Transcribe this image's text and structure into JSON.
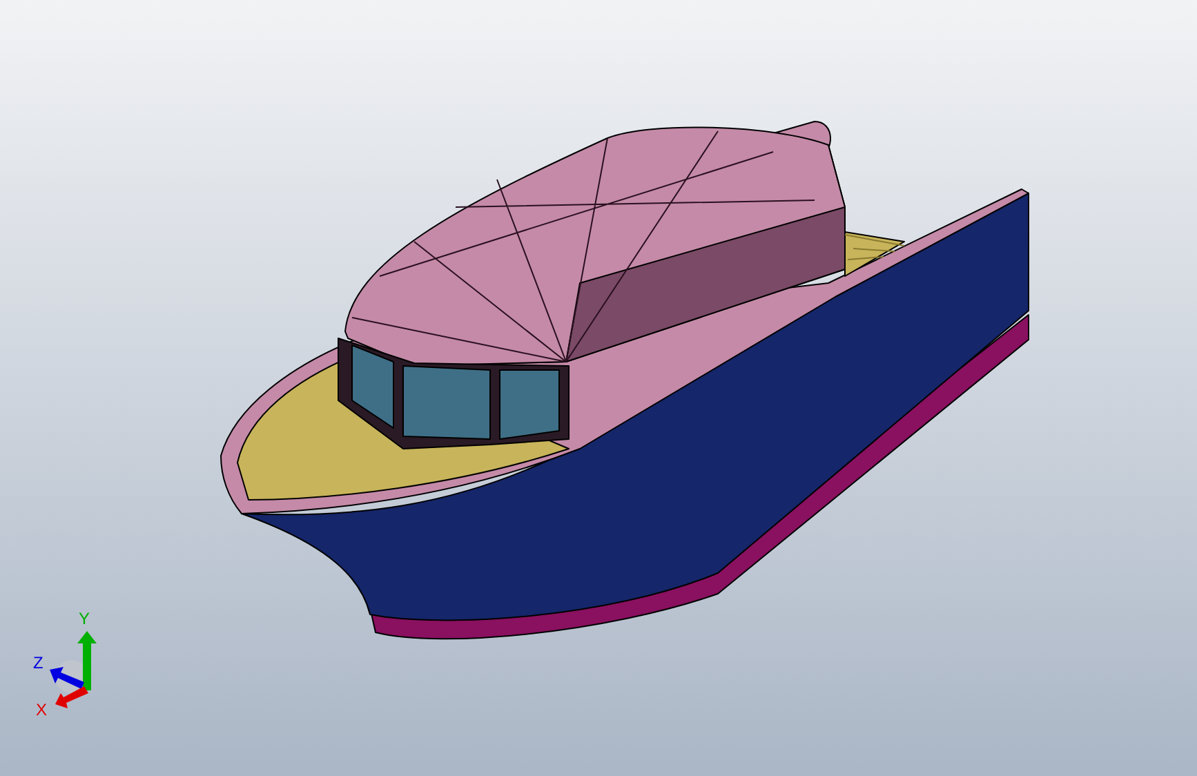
{
  "axis_triad": {
    "axes": [
      {
        "label": "Y",
        "color": "#00b000"
      },
      {
        "label": "Z",
        "color": "#0000e0"
      },
      {
        "label": "X",
        "color": "#e00000"
      }
    ]
  }
}
